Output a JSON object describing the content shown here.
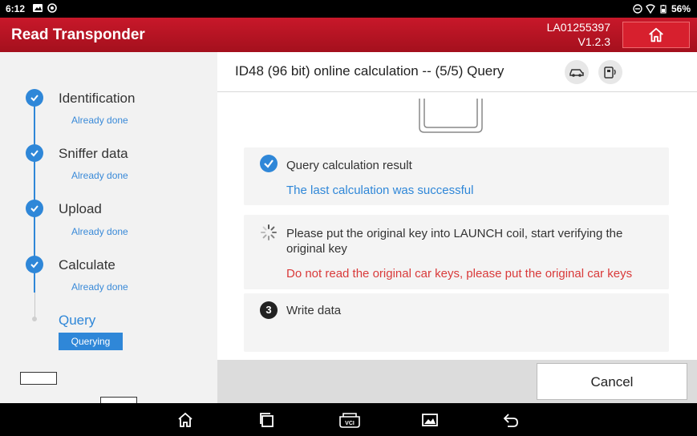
{
  "status_bar": {
    "time": "6:12",
    "battery": "56%"
  },
  "title_bar": {
    "title": "Read Transponder",
    "serial": "LA01255397",
    "version": "V1.2.3",
    "home_icon": "home-icon"
  },
  "steps": [
    {
      "name": "Identification",
      "status": "Already done"
    },
    {
      "name": "Sniffer data",
      "status": "Already done"
    },
    {
      "name": "Upload",
      "status": "Already done"
    },
    {
      "name": "Calculate",
      "status": "Already done"
    },
    {
      "name": "Query",
      "status": "Querying"
    }
  ],
  "header": {
    "title": "ID48 (96 bit) online calculation -- (5/5) Query",
    "icons": [
      "car-icon",
      "vci-device-icon"
    ]
  },
  "cards": [
    {
      "text": "Query calculation result",
      "detail": "The last calculation was successful",
      "icon": "check-icon"
    },
    {
      "text": "Please put the original key into LAUNCH coil, start verifying the original key",
      "detail": "Do not read the original car keys, please put the original car keys",
      "icon": "spinner-icon"
    },
    {
      "text": "Write data",
      "number": "3"
    }
  ],
  "footer": {
    "cancel_label": "Cancel"
  },
  "colors": {
    "brand_red": "#c8182a",
    "accent_blue": "#2f87d8",
    "warning_red": "#d93a3a"
  },
  "nav_bar": {
    "icons": [
      "home-icon",
      "recent-apps-icon",
      "vci-icon",
      "gallery-icon",
      "back-icon"
    ],
    "vci_label": "VCI"
  }
}
